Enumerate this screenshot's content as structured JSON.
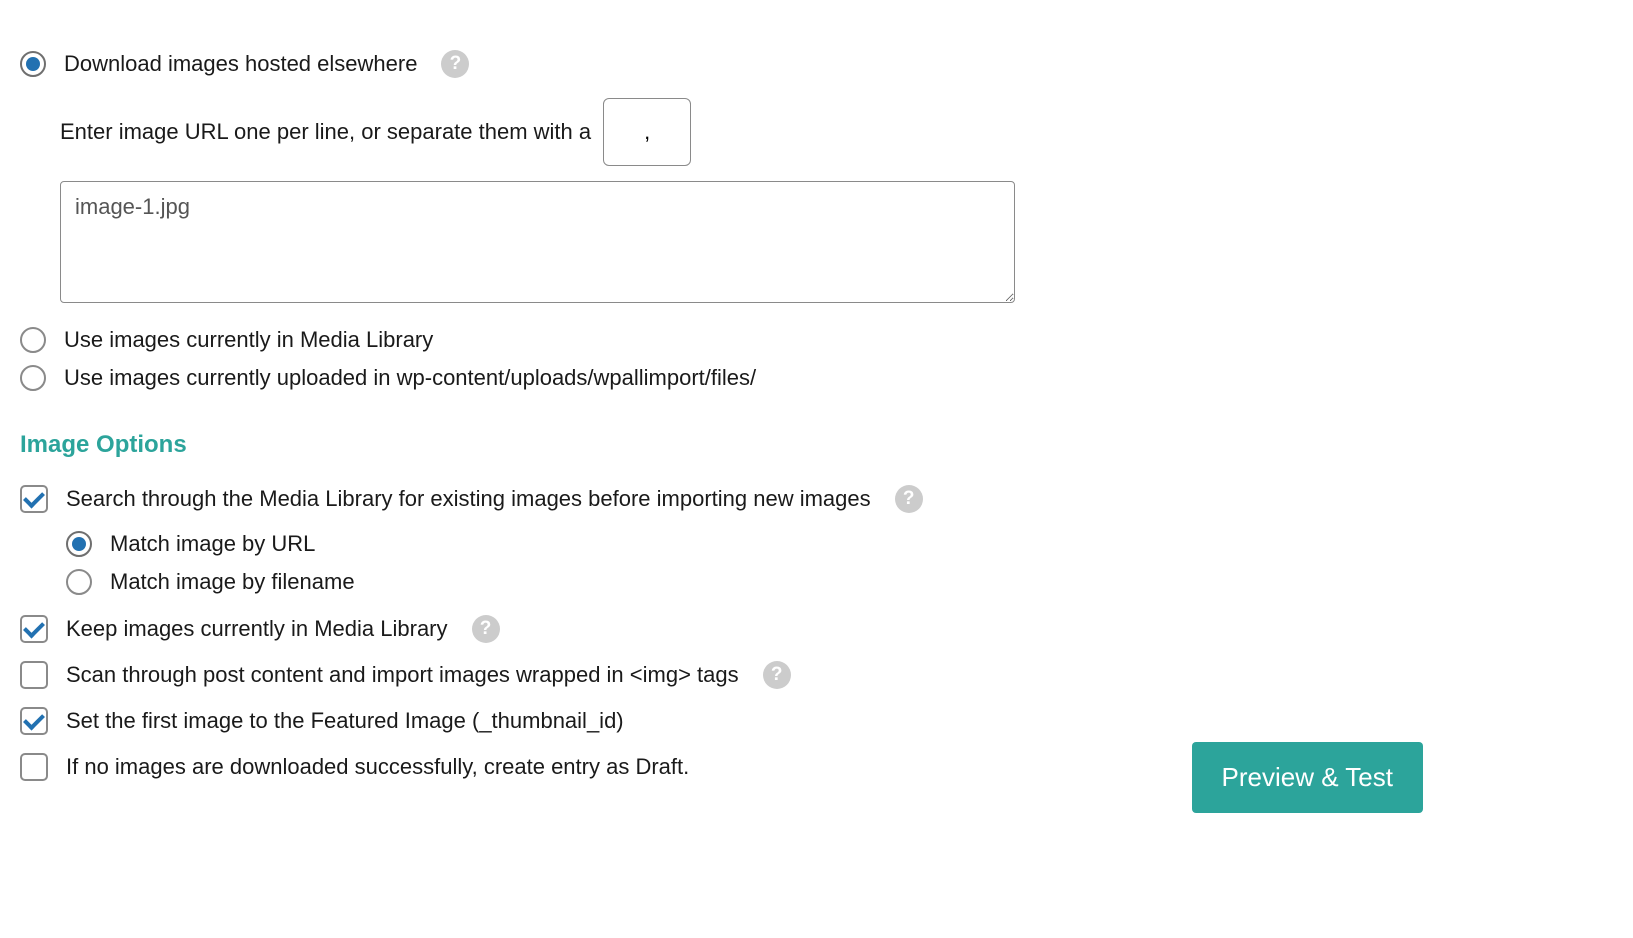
{
  "image_source": {
    "download_elsewhere": {
      "label": "Download images hosted elsewhere",
      "selected": true,
      "instruction": "Enter image URL one per line, or separate them with a",
      "separator_value": ",",
      "textarea_value": "image-1.jpg"
    },
    "use_media_library": {
      "label": "Use images currently in Media Library",
      "selected": false
    },
    "use_uploads": {
      "label": "Use images currently uploaded in wp-content/uploads/wpallimport/files/",
      "selected": false
    }
  },
  "image_options": {
    "heading": "Image Options",
    "search_media": {
      "label": "Search through the Media Library for existing images before importing new images",
      "checked": true,
      "match_by_url": {
        "label": "Match image by URL",
        "selected": true
      },
      "match_by_filename": {
        "label": "Match image by filename",
        "selected": false
      }
    },
    "keep_images": {
      "label": "Keep images currently in Media Library",
      "checked": true
    },
    "scan_post_content": {
      "label": "Scan through post content and import images wrapped in <img> tags",
      "checked": false
    },
    "set_featured": {
      "label": "Set the first image to the Featured Image (_thumbnail_id)",
      "checked": true
    },
    "create_draft": {
      "label": "If no images are downloaded successfully, create entry as Draft.",
      "checked": false
    }
  },
  "buttons": {
    "preview_test": "Preview & Test"
  },
  "help_glyph": "?"
}
